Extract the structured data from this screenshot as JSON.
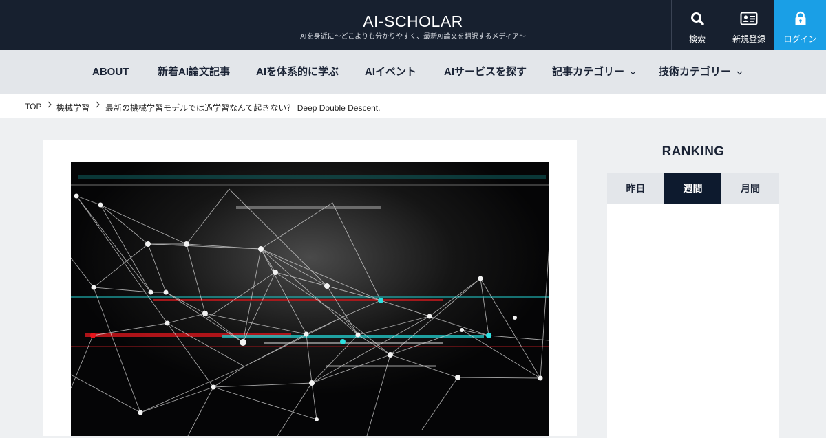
{
  "header": {
    "title": "AI-SCHOLAR",
    "subtitle": "AIを身近に〜どこよりも分かりやすく、最新AI論文を翻訳するメディア〜",
    "search_label": "検索",
    "register_label": "新規登録",
    "login_label": "ログイン",
    "accent_color": "#1a9fe6"
  },
  "nav": {
    "items": [
      {
        "label": "ABOUT"
      },
      {
        "label": "新着AI論文記事"
      },
      {
        "label": "AIを体系的に学ぶ"
      },
      {
        "label": "AIイベント"
      },
      {
        "label": "AIサービスを探す"
      },
      {
        "label": "記事カテゴリー"
      },
      {
        "label": "技術カテゴリー"
      }
    ]
  },
  "breadcrumb": {
    "items": [
      {
        "label": "TOP"
      },
      {
        "label": "機械学習"
      },
      {
        "label": "最新の機械学習モデルでは過学習なんて起きない？ Deep Double Descent."
      }
    ]
  },
  "sidebar": {
    "ranking_title": "RANKING",
    "tabs": [
      {
        "label": "昨日"
      },
      {
        "label": "週間"
      },
      {
        "label": "月間"
      }
    ],
    "active_tab": "週間"
  }
}
